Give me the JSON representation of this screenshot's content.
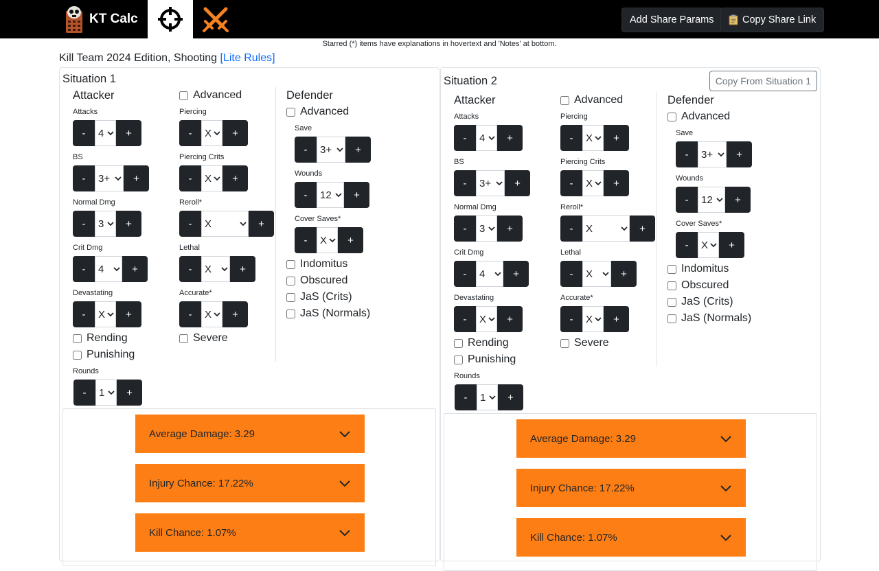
{
  "nav": {
    "brand": "KT Calc",
    "add_share_label": "Add Share Params",
    "copy_share_label": "Copy Share Link",
    "icons": [
      "skull-calculator-icon",
      "crosshair-icon",
      "crossed-swords-icon",
      "clipboard-icon"
    ]
  },
  "notice": "Starred (*) items have explanations in hovertext and 'Notes' at bottom.",
  "heading": {
    "text": "Kill Team 2024 Edition, Shooting",
    "link": "[Lite Rules]"
  },
  "situations": [
    {
      "title": "Situation 1",
      "attacker_title": "Attacker",
      "advanced": "Advanced",
      "attacks_label": "Attacks",
      "attacks": "4",
      "bs_label": "BS",
      "bs": "3+",
      "normal_dmg_label": "Normal Dmg",
      "normal_dmg": "3",
      "crit_dmg_label": "Crit Dmg",
      "crit_dmg": "4",
      "devastating_label": "Devastating",
      "devastating": "X",
      "rending": "Rending",
      "punishing": "Punishing",
      "rounds_label": "Rounds",
      "rounds": "1",
      "piercing_label": "Piercing",
      "piercing": "X",
      "piercing_crits_label": "Piercing Crits",
      "piercing_crits": "X",
      "reroll_label": "Reroll*",
      "reroll": "X",
      "lethal_label": "Lethal",
      "lethal": "X",
      "accurate_label": "Accurate*",
      "accurate": "X",
      "severe": "Severe",
      "defender_title": "Defender",
      "def_advanced": "Advanced",
      "save_label": "Save",
      "save": "3+",
      "wounds_label": "Wounds",
      "wounds": "12",
      "cover_label": "Cover Saves*",
      "cover": "X",
      "indomitus": "Indomitus",
      "obscured": "Obscured",
      "jas_crits": "JaS (Crits)",
      "jas_normals": "JaS (Normals)",
      "avg_damage": "Average Damage: 3.29",
      "injury_chance": "Injury Chance: 17.22%",
      "kill_chance": "Kill Chance: 1.07%"
    },
    {
      "title": "Situation 2",
      "copy_label": "Copy From Situation 1",
      "attacker_title": "Attacker",
      "advanced": "Advanced",
      "attacks_label": "Attacks",
      "attacks": "4",
      "bs_label": "BS",
      "bs": "3+",
      "normal_dmg_label": "Normal Dmg",
      "normal_dmg": "3",
      "crit_dmg_label": "Crit Dmg",
      "crit_dmg": "4",
      "devastating_label": "Devastating",
      "devastating": "X",
      "rending": "Rending",
      "punishing": "Punishing",
      "rounds_label": "Rounds",
      "rounds": "1",
      "piercing_label": "Piercing",
      "piercing": "X",
      "piercing_crits_label": "Piercing Crits",
      "piercing_crits": "X",
      "reroll_label": "Reroll*",
      "reroll": "X",
      "lethal_label": "Lethal",
      "lethal": "X",
      "accurate_label": "Accurate*",
      "accurate": "X",
      "severe": "Severe",
      "defender_title": "Defender",
      "def_advanced": "Advanced",
      "save_label": "Save",
      "save": "3+",
      "wounds_label": "Wounds",
      "wounds": "12",
      "cover_label": "Cover Saves*",
      "cover": "X",
      "indomitus": "Indomitus",
      "obscured": "Obscured",
      "jas_crits": "JaS (Crits)",
      "jas_normals": "JaS (Normals)",
      "avg_damage": "Average Damage: 3.29",
      "injury_chance": "Injury Chance: 17.22%",
      "kill_chance": "Kill Chance: 1.07%"
    }
  ],
  "buttons": {
    "minus": "-",
    "plus": "+"
  },
  "colors": {
    "navbar": "#000000",
    "dark_button": "#212529",
    "result_orange": "#fd7e14",
    "link": "#0d6efd"
  }
}
